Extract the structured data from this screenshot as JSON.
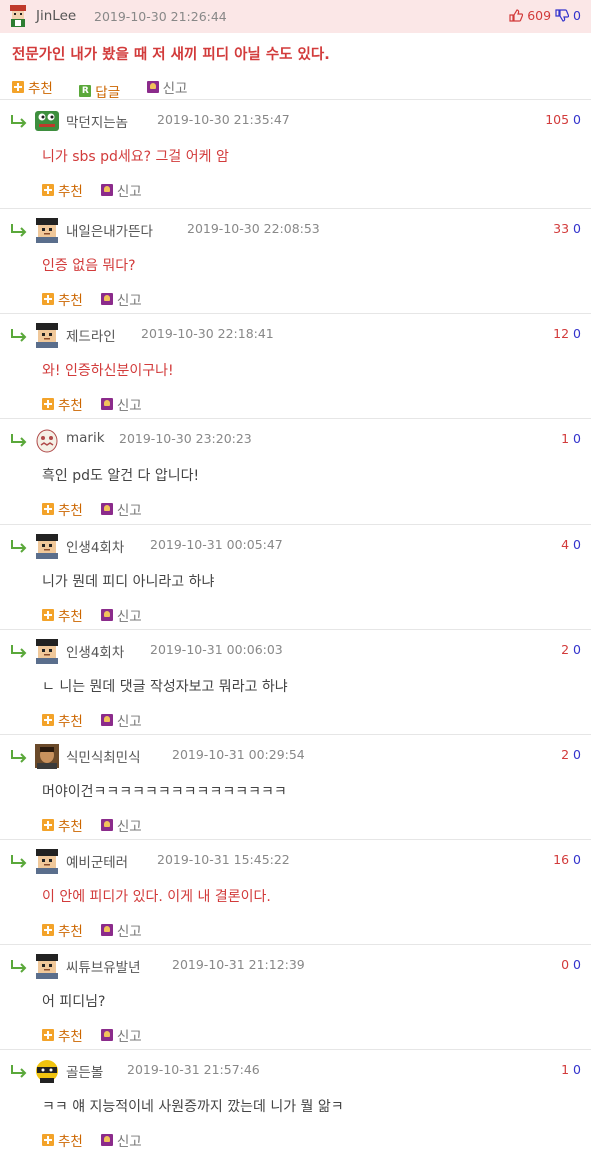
{
  "post": {
    "author": "JinLee",
    "timestamp": "2019-10-30 21:26:44",
    "upvotes": "609",
    "downvotes": "0",
    "text": "전문가인 내가 봤을 때 저 새끼 피디 아닐 수도 있다.",
    "actions": {
      "recommend": "추천",
      "reply": "답글",
      "report": "신고"
    }
  },
  "labels": {
    "recommend": "추천",
    "report": "신고"
  },
  "comments": [
    {
      "author": "막던지는놈",
      "timestamp": "2019-10-30 21:35:47",
      "up": "105",
      "down": "0",
      "text": "니가 sbs pd세요? 그걸 어케 암",
      "red": true,
      "avatar": "frog"
    },
    {
      "author": "내일은내가뜬다",
      "timestamp": "2019-10-30 22:08:53",
      "up": "33",
      "down": "0",
      "text": "인증 없음 뭐다?",
      "red": true,
      "avatar": "pixel"
    },
    {
      "author": "제드라인",
      "timestamp": "2019-10-30 22:18:41",
      "up": "12",
      "down": "0",
      "text": "와! 인증하신분이구나!",
      "red": true,
      "avatar": "pixel"
    },
    {
      "author": "marik",
      "timestamp": "2019-10-30 23:20:23",
      "up": "1",
      "down": "0",
      "text": "흑인 pd도 알건 다 압니다!",
      "red": false,
      "avatar": "egg"
    },
    {
      "author": "인생4회차",
      "timestamp": "2019-10-31 00:05:47",
      "up": "4",
      "down": "0",
      "text": "니가 뭔데 피디 아니라고 하냐",
      "red": false,
      "avatar": "pixel"
    },
    {
      "author": "인생4회차",
      "timestamp": "2019-10-31 00:06:03",
      "up": "2",
      "down": "0",
      "text": "ㄴ 니는 뭔데 댓글 작성자보고 뭐라고 하냐",
      "red": false,
      "avatar": "pixel"
    },
    {
      "author": "식민식최민식",
      "timestamp": "2019-10-31 00:29:54",
      "up": "2",
      "down": "0",
      "text": "머야이건ㅋㅋㅋㅋㅋㅋㅋㅋㅋㅋㅋㅋㅋㅋㅋ",
      "red": false,
      "avatar": "photo"
    },
    {
      "author": "예비군테러",
      "timestamp": "2019-10-31 15:45:22",
      "up": "16",
      "down": "0",
      "text": "이 안에 피디가 있다. 이게 내 결론이다.",
      "red": true,
      "avatar": "pixel"
    },
    {
      "author": "씨튜브유발년",
      "timestamp": "2019-10-31 21:12:39",
      "up": "0",
      "down": "0",
      "text": "어 피디님?",
      "red": false,
      "avatar": "pixel"
    },
    {
      "author": "골든볼",
      "timestamp": "2019-10-31 21:57:46",
      "up": "1",
      "down": "0",
      "text": "ㅋㅋ 얘 지능적이네 사원증까지 깠는데 니가 뭘 앎ㅋ",
      "red": false,
      "avatar": "ninja"
    }
  ],
  "colors": {
    "accent_red": "#d23b3b",
    "vote_down": "#3333cc",
    "header_bg": "#fbe7e7"
  }
}
